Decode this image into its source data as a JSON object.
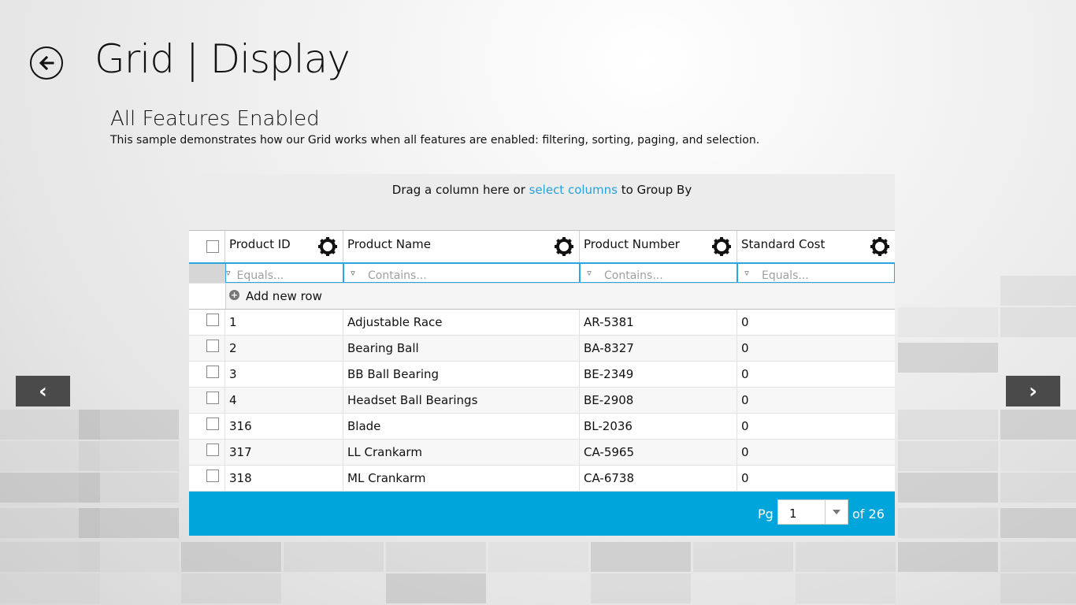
{
  "header": {
    "title": "Grid | Display",
    "back_icon": "back-arrow-icon"
  },
  "sample": {
    "subtitle": "All Features Enabled",
    "description": "This sample demonstrates how our Grid works when all features are enabled: filtering, sorting, paging, and selection."
  },
  "group_panel": {
    "text_before": "Drag a column here or ",
    "link": "select columns",
    "text_after": " to Group By"
  },
  "columns": [
    {
      "label": "Product ID",
      "filter_placeholder": "Equals..."
    },
    {
      "label": "Product Name",
      "filter_placeholder": "Contains..."
    },
    {
      "label": "Product Number",
      "filter_placeholder": "Contains..."
    },
    {
      "label": "Standard Cost",
      "filter_placeholder": "Equals..."
    }
  ],
  "add_row_label": "Add new row",
  "rows": [
    [
      "1",
      "Adjustable Race",
      "AR-5381",
      "0"
    ],
    [
      "2",
      "Bearing Ball",
      "BA-8327",
      "0"
    ],
    [
      "3",
      "BB Ball Bearing",
      "BE-2349",
      "0"
    ],
    [
      "4",
      "Headset Ball Bearings",
      "BE-2908",
      "0"
    ],
    [
      "316",
      "Blade",
      "BL-2036",
      "0"
    ],
    [
      "317",
      "LL Crankarm",
      "CA-5965",
      "0"
    ],
    [
      "318",
      "ML Crankarm",
      "CA-6738",
      "0"
    ]
  ],
  "pager": {
    "label": "Pg",
    "current": "1",
    "of_text": "of 26"
  },
  "nav": {
    "prev_glyph": "‹",
    "next_glyph": "›"
  },
  "colors": {
    "accent": "#00a5dc",
    "link": "#2aa0d8",
    "nav_button": "#4a4a4a"
  }
}
